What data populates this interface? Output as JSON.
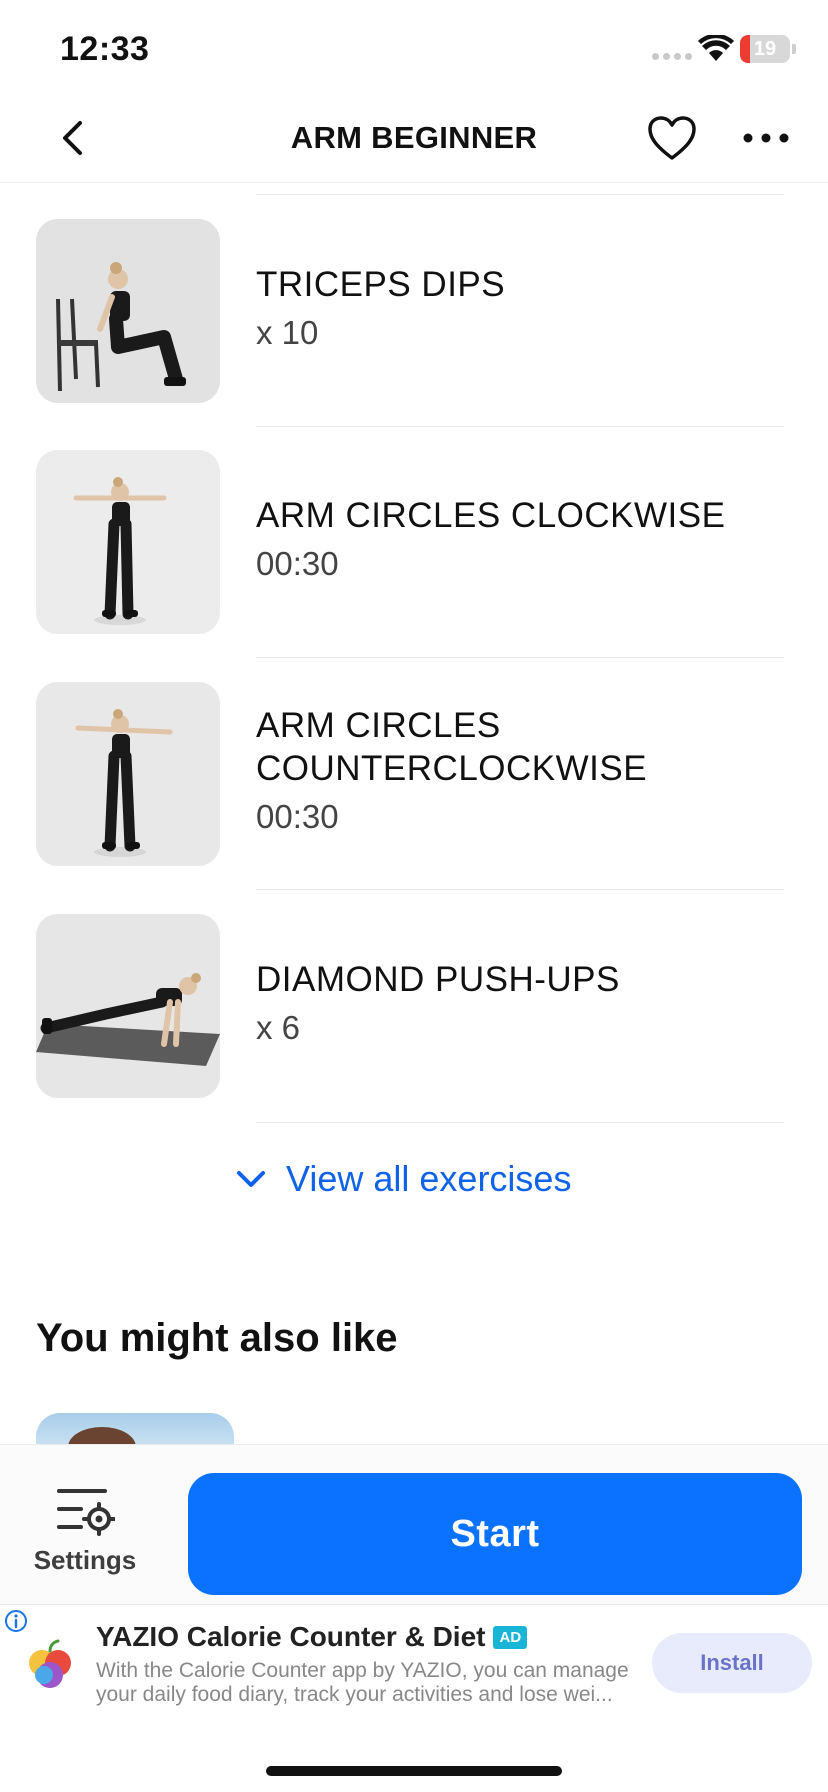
{
  "status_bar": {
    "time": "12:33",
    "battery_level": "19",
    "battery_fraction": 0.19
  },
  "header": {
    "title": "ARM BEGINNER",
    "back_icon": "chevron-left-icon",
    "favorite_icon": "heart-icon",
    "more_icon": "ellipsis-icon"
  },
  "exercises": [
    {
      "name": "TRICEPS DIPS",
      "amount": "x 10",
      "thumbnail": "triceps-dips-image"
    },
    {
      "name": "ARM CIRCLES CLOCKWISE",
      "amount": "00:30",
      "thumbnail": "arm-circles-clockwise-image"
    },
    {
      "name": "ARM CIRCLES COUNTERCLOCKWISE",
      "amount": "00:30",
      "thumbnail": "arm-circles-counterclockwise-image"
    },
    {
      "name": "DIAMOND PUSH-UPS",
      "amount": "x 6",
      "thumbnail": "diamond-push-ups-image"
    }
  ],
  "view_all": {
    "label": "View all exercises",
    "icon": "chevron-down-icon"
  },
  "suggestions": {
    "title": "You might also like"
  },
  "bottom_bar": {
    "settings_label": "Settings",
    "start_label": "Start"
  },
  "ad": {
    "title": "YAZIO Calorie Counter & Diet",
    "badge": "AD",
    "description_line1": "With the Calorie Counter app by YAZIO, you can manage",
    "description_line2": "your daily food diary, track your activities and lose wei...",
    "install_label": "Install"
  },
  "colors": {
    "accent": "#0a72ff",
    "link": "#1062e8",
    "battery_low": "#ec3b31",
    "ad_badge": "#18b5d6"
  }
}
